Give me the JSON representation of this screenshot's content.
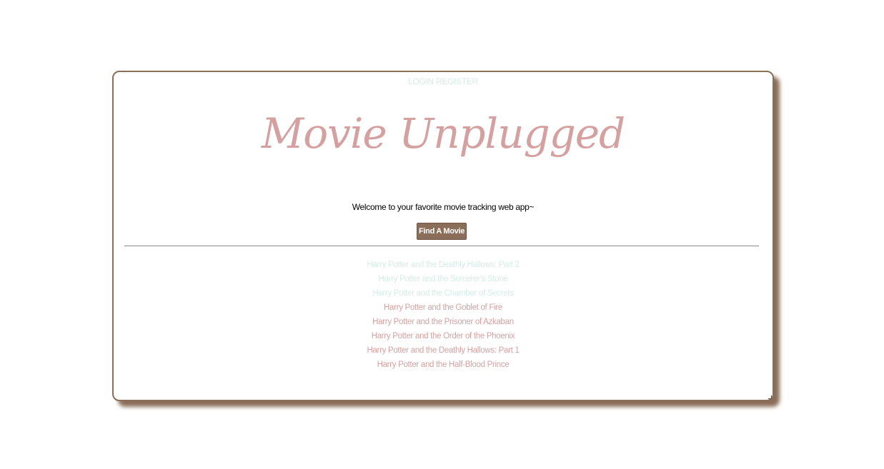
{
  "nav": {
    "login_label": "LOGIN",
    "register_label": "REGISTER"
  },
  "header": {
    "title": "Movie Unplugged",
    "welcome": "Welcome to your favorite movie tracking web app~"
  },
  "actions": {
    "find_movie_label": "Find A Movie"
  },
  "movies": [
    {
      "title": "Harry Potter and the Deathly Hallows: Part 2",
      "style": "faded"
    },
    {
      "title": "Harry Potter and the Sorcerer's Stone",
      "style": "faded"
    },
    {
      "title": "Harry Potter and the Chamber of Secrets",
      "style": "faded"
    },
    {
      "title": "Harry Potter and the Goblet of Fire",
      "style": "pink"
    },
    {
      "title": "Harry Potter and the Prisoner of Azkaban",
      "style": "pink"
    },
    {
      "title": "Harry Potter and the Order of the Phoenix",
      "style": "pink"
    },
    {
      "title": "Harry Potter and the Deathly Hallows: Part 1",
      "style": "pink"
    },
    {
      "title": "Harry Potter and the Half-Blood Prince",
      "style": "pink"
    }
  ],
  "colors": {
    "accent_brown": "#8b6e5a",
    "title_pink": "#d4a1a0",
    "faded_mint": "#d6ece6"
  }
}
